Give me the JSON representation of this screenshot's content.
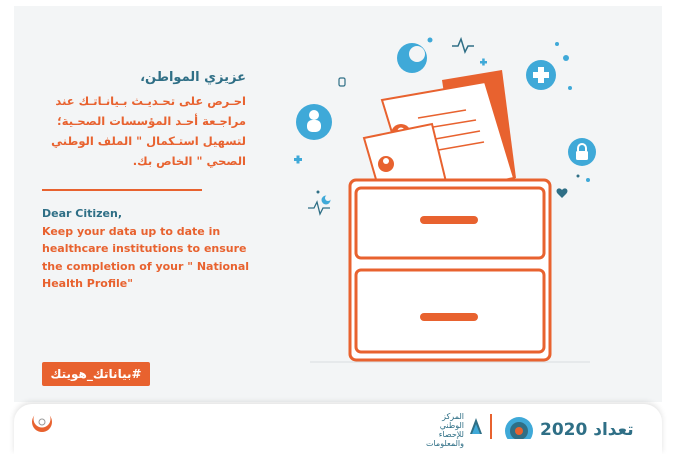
{
  "arabic": {
    "greeting": "عزيزي المواطن،",
    "lines": [
      "احـرص على تحـديـث بـيانـاتـك عند",
      "مراجـعة أحـد المؤسسات الصحـية؛",
      "لتسهيل استـكمال \" الملف الوطني",
      "الصحي \" الخاص بك."
    ]
  },
  "english": {
    "greeting": "Dear Citizen,",
    "lines": [
      "Keep your data up to date in",
      "healthcare institutions to ensure",
      "the completion of your \" National",
      "Health Profile\""
    ]
  },
  "hashtag": "#بياناتك_هويتك",
  "footer": {
    "center_label_lines": [
      "المركز الوطني",
      "للإحصاء",
      "والمعلومات"
    ],
    "census_text": "تعداد 2020"
  },
  "colors": {
    "orange": "#e8622f",
    "teal": "#2f6f86",
    "blue": "#3fa9d8",
    "panel": "#f3f5f6"
  },
  "icons": [
    "moon-icon",
    "plus-icon",
    "person-icon",
    "lock-icon",
    "heartbeat-icon",
    "heart-icon",
    "cabinet-illustration",
    "document-icon"
  ]
}
